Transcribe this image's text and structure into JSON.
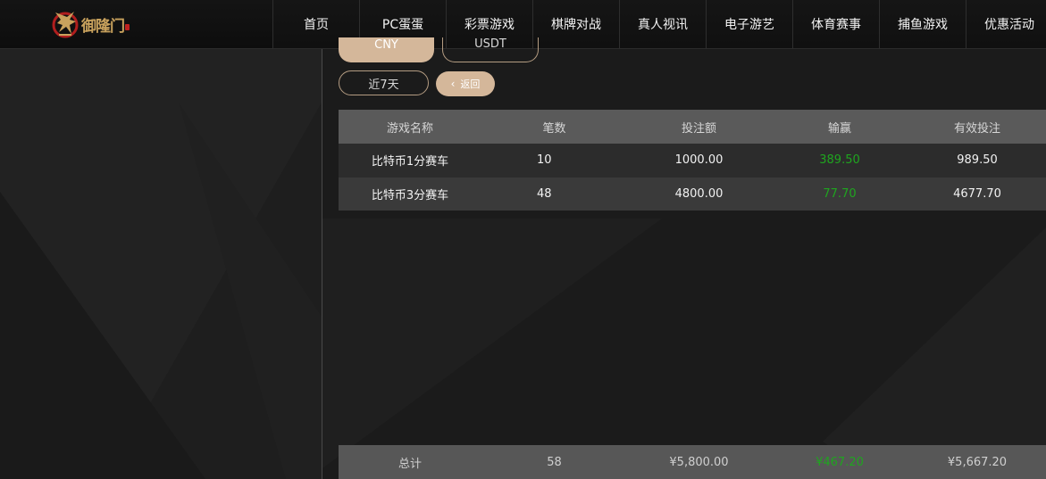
{
  "brand": {
    "logo_text": "御隆门"
  },
  "nav": {
    "items": [
      {
        "label": "首页"
      },
      {
        "label": "PC蛋蛋"
      },
      {
        "label": "彩票游戏"
      },
      {
        "label": "棋牌对战"
      },
      {
        "label": "真人视讯"
      },
      {
        "label": "电子游艺"
      },
      {
        "label": "体育赛事"
      },
      {
        "label": "捕鱼游戏"
      },
      {
        "label": "优惠活动"
      }
    ]
  },
  "filters": {
    "currency_cny": "CNY",
    "currency_usdt": "USDT",
    "range": "近7天",
    "back": "返回",
    "back_icon": "chevron-left-icon"
  },
  "table": {
    "headers": [
      "游戏名称",
      "笔数",
      "投注额",
      "输赢",
      "有效投注"
    ],
    "rows": [
      {
        "name": "比特币1分赛车",
        "count": "10",
        "bet": "1000.00",
        "win": "389.50",
        "valid": "989.50"
      },
      {
        "name": "比特币3分赛车",
        "count": "48",
        "bet": "4800.00",
        "win": "77.70",
        "valid": "4677.70"
      }
    ],
    "win_color": "#1fa51f"
  },
  "totals": {
    "label": "总计",
    "count": "58",
    "bet": "¥5,800.00",
    "win": "¥467.20",
    "valid": "¥5,667.20"
  }
}
